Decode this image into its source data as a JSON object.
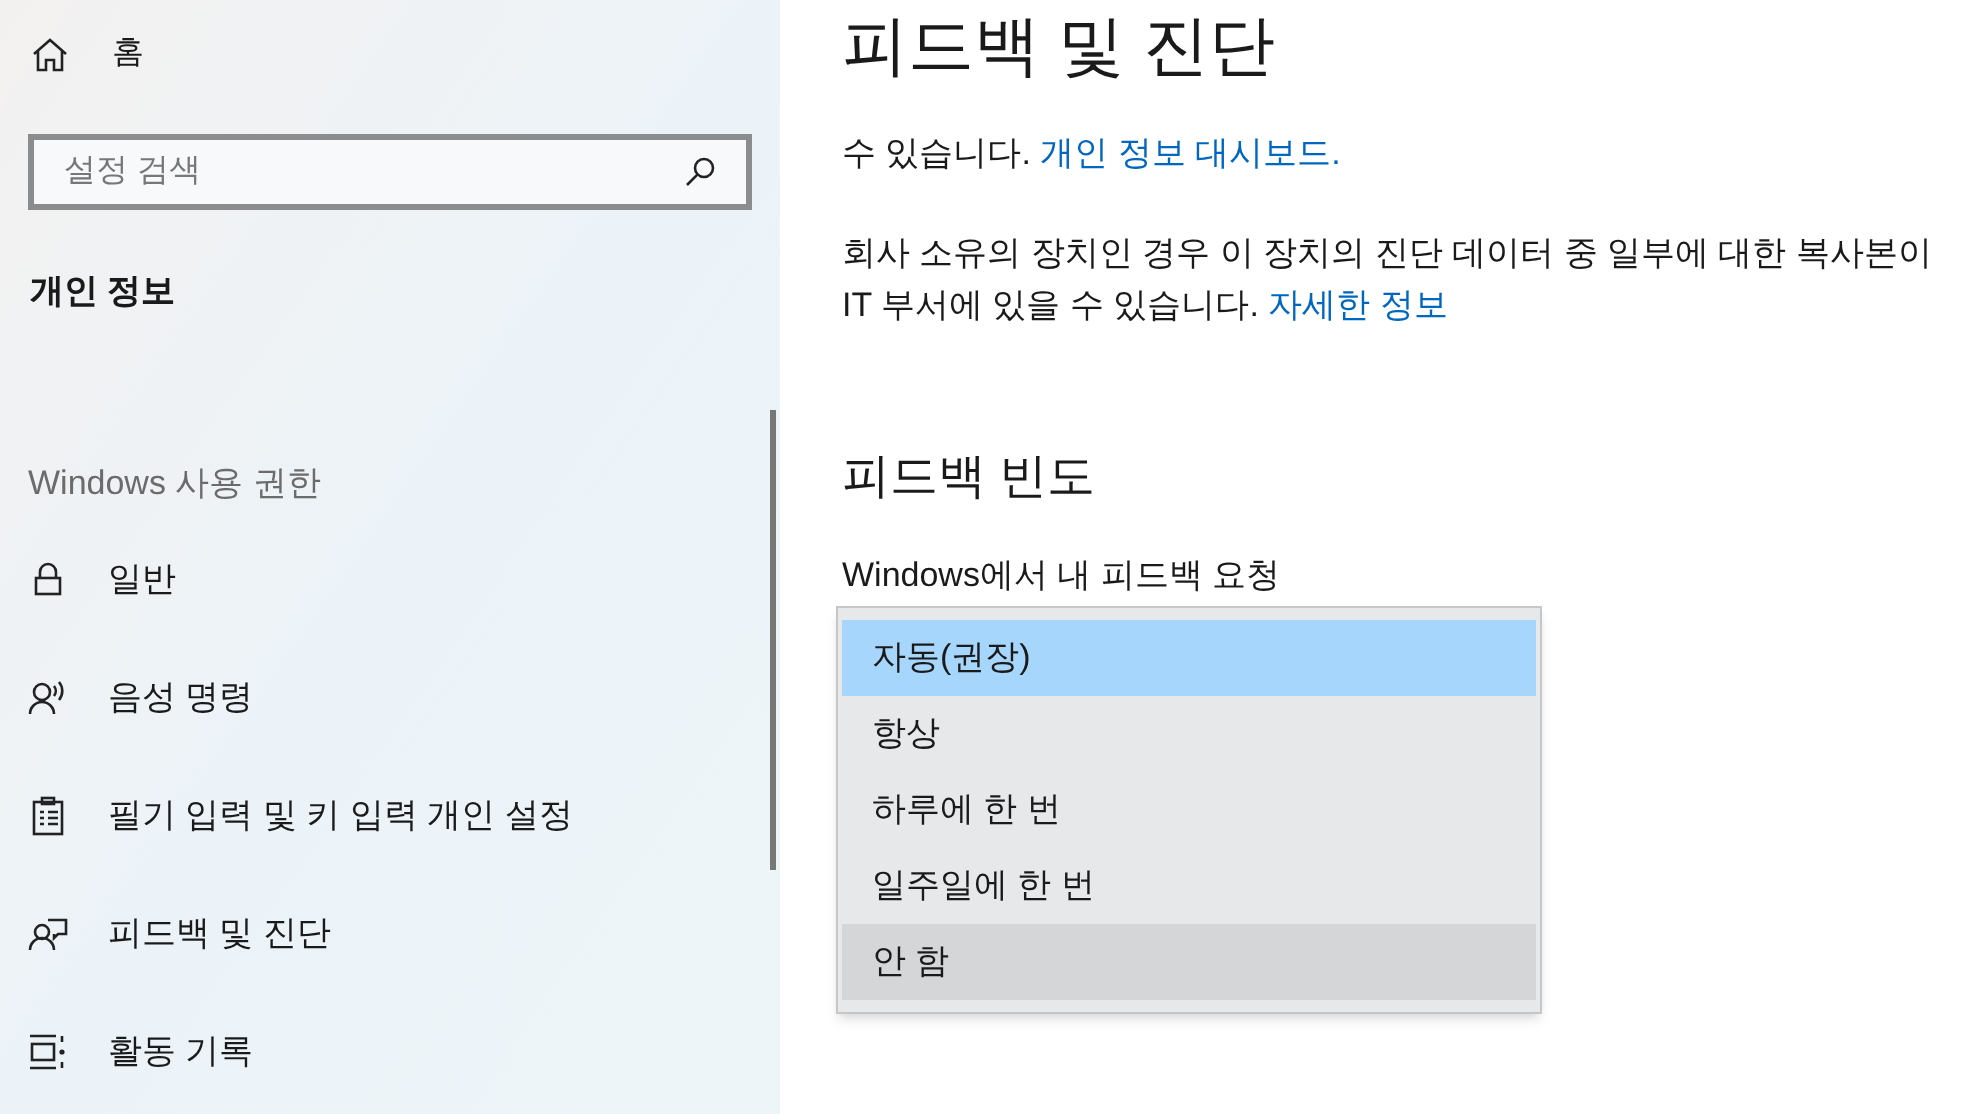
{
  "sidebar": {
    "home": {
      "label": "홈"
    },
    "search": {
      "placeholder": "설정 검색"
    },
    "section_title": "개인 정보",
    "group_label": "Windows 사용 권한",
    "items": [
      {
        "kind": "lock",
        "label": "일반"
      },
      {
        "kind": "voice",
        "label": "음성 명령"
      },
      {
        "kind": "clipboard",
        "label": "필기 입력 및 키 입력 개인 설정"
      },
      {
        "kind": "feedback",
        "label": "피드백 및 진단"
      },
      {
        "kind": "timeline",
        "label": "활동 기록"
      }
    ]
  },
  "content": {
    "title": "피드백 및 진단",
    "paragraphs": [
      {
        "text": "수 있습니다.",
        "link": "개인 정보 대시보드."
      },
      {
        "text": "회사 소유의 장치인 경우 이 장치의 진단 데이터 중 일부에 대한 복사본이 IT 부서에 있을 수 있습니다.",
        "link": "자세한 정보"
      }
    ],
    "section_heading": "피드백 빈도",
    "field_label": "Windows에서 내 피드백 요청",
    "dropdown_options": [
      {
        "label": "자동(권장)",
        "selected": true,
        "hovered": false
      },
      {
        "label": "항상",
        "selected": false,
        "hovered": false
      },
      {
        "label": "하루에 한 번",
        "selected": false,
        "hovered": false
      },
      {
        "label": "일주일에 한 번",
        "selected": false,
        "hovered": false
      },
      {
        "label": "안 함",
        "selected": false,
        "hovered": true
      }
    ]
  }
}
